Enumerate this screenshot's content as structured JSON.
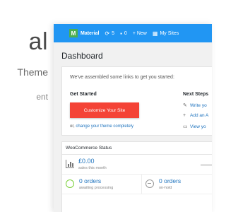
{
  "promo": {
    "title": "al",
    "subtitle": "Theme",
    "small": "ent"
  },
  "adminbar": {
    "color": "#2196f3",
    "logo_letter": "M",
    "logo_color": "#4caf50",
    "site_name": "Material",
    "updates_count": "5",
    "comments_count": "0",
    "new_label": "+ New",
    "my_sites_label": "My Sites"
  },
  "page_title": "Dashboard",
  "welcome": {
    "intro": "We've assembled some links to get you started:",
    "get_started": "Get Started",
    "customize_button": "Customize Your Site",
    "change_prefix": "or, ",
    "change_link": "change your theme completely",
    "next_steps": "Next Steps",
    "next_items": [
      {
        "icon": "edit-icon",
        "label": "Write yo"
      },
      {
        "icon": "plus-icon",
        "label": "Add an A"
      },
      {
        "icon": "view-icon",
        "label": "View yo"
      }
    ]
  },
  "woocommerce": {
    "title": "WooCommerce Status",
    "sales_amount": "£0.00",
    "sales_label": "sales this month",
    "orders": [
      {
        "value": "0 orders",
        "label": "awaiting processing",
        "status_color": "#7ad03a"
      },
      {
        "value": "0 orders",
        "label": "on-hold",
        "status_color": "#999999"
      }
    ]
  }
}
